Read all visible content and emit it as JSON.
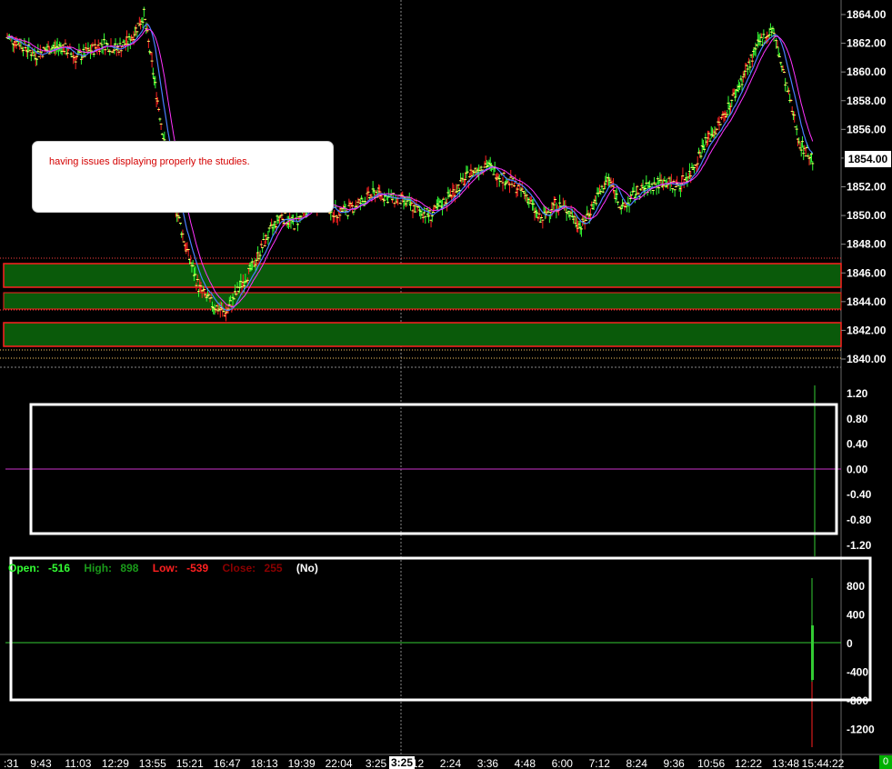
{
  "price_axis": {
    "labels": [
      "1864.00",
      "1862.00",
      "1860.00",
      "1858.00",
      "1856.00",
      "1854.00",
      "1852.00",
      "1850.00",
      "1848.00",
      "1846.00",
      "1844.00",
      "1842.00",
      "1840.00"
    ],
    "current_price": "1854.00",
    "ylim": [
      1840,
      1864
    ]
  },
  "osc_axis": {
    "labels": [
      "1.20",
      "0.80",
      "0.40",
      "0.00",
      "-0.40",
      "-0.80",
      "-1.20"
    ]
  },
  "vol_axis": {
    "labels": [
      "800",
      "400",
      "0",
      "-400",
      "-800",
      "-1200"
    ]
  },
  "time_axis": {
    "labels": [
      ":31",
      "9:43",
      "11:03",
      "12:29",
      "13:55",
      "15:21",
      "16:47",
      "18:13",
      "19:39",
      "22:04",
      "3:25",
      "1:12",
      "2:24",
      "3:36",
      "4:48",
      "6:00",
      "7:12",
      "8:24",
      "9:36",
      "10:56",
      "12:22",
      "13:48",
      "15:44:22"
    ],
    "highlighted": "3:25"
  },
  "note": {
    "text": "having issues displaying properly the studies."
  },
  "ohlc_readout": {
    "open_label": "Open:",
    "open_value": "-516",
    "high_label": "High:",
    "high_value": "898",
    "low_label": "Low:",
    "low_value": "-539",
    "close_label": "Close:",
    "close_value": "255",
    "mode": "(No)"
  },
  "corner_badge": "0",
  "colors": {
    "background": "#000000",
    "up_bar": "#33ff33",
    "down_bar": "#ff2222",
    "ma_blue": "#4a7dff",
    "ma_magenta": "#ff33ff",
    "zone_fill": "#0a5a0a",
    "zone_border": "#ff2020",
    "osc_line": "#cc33cc",
    "vol_line": "#33cc33",
    "annotation_box": "#ffffff"
  },
  "chart_data": {
    "type": "line",
    "title": "",
    "price_series": [
      1862.4,
      1862.0,
      1861.2,
      1861.6,
      1861.8,
      1861.0,
      1861.4,
      1862.0,
      1861.6,
      1862.2,
      1864.0,
      1858.0,
      1852.0,
      1848.0,
      1845.0,
      1843.8,
      1843.2,
      1845.0,
      1846.5,
      1848.5,
      1850.0,
      1849.4,
      1850.5,
      1851.0,
      1850.2,
      1850.4,
      1851.0,
      1851.6,
      1851.2,
      1851.0,
      1850.4,
      1850.0,
      1851.0,
      1852.0,
      1853.0,
      1853.6,
      1852.8,
      1852.2,
      1851.4,
      1849.6,
      1850.8,
      1850.4,
      1849.2,
      1851.0,
      1852.6,
      1850.4,
      1851.6,
      1852.0,
      1852.4,
      1852.0,
      1853.0,
      1855.0,
      1856.2,
      1858.0,
      1860.0,
      1862.0,
      1863.0,
      1859.0,
      1855.0,
      1853.8
    ]
  }
}
